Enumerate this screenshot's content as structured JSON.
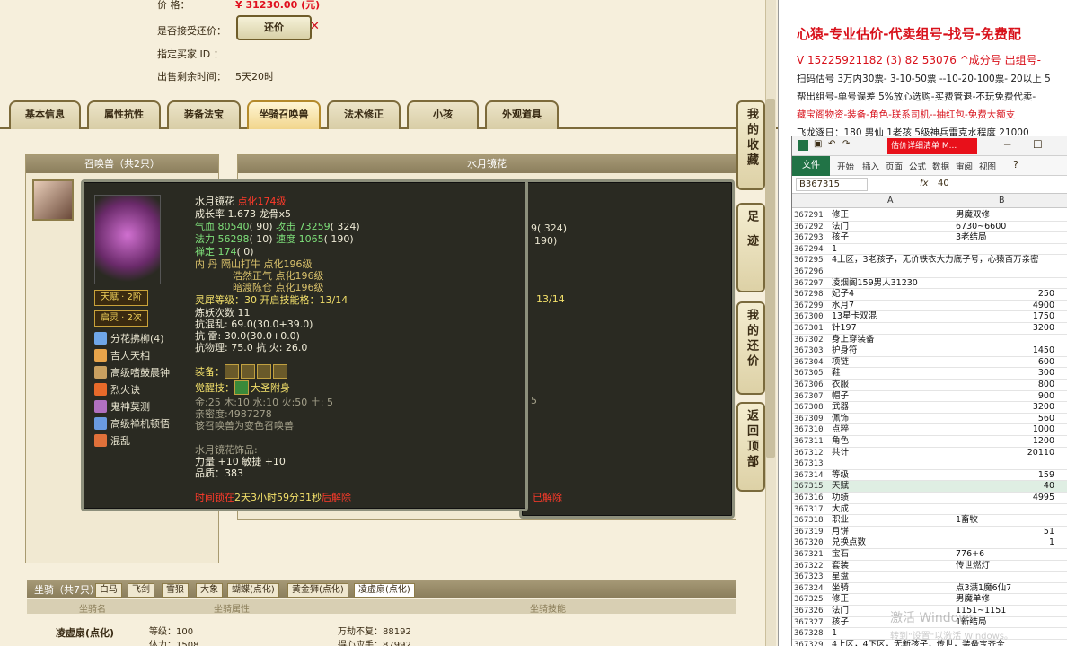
{
  "listing": {
    "price_label": "价        格：",
    "price_value": "¥ 31230.00 (元)",
    "accept_counter_label": "是否接受还价：",
    "counter_button": "还价",
    "counter_close": "✕",
    "buyer_label": "指定买家 ID ：",
    "time_left_label": "出售剩余时间：",
    "time_left_value": "5天20时"
  },
  "tabs": [
    "基本信息",
    "属性抗性",
    "装备法宝",
    "坐骑召唤兽",
    "法术修正",
    "小孩",
    "外观道具"
  ],
  "active_tab": 3,
  "summon_panel": {
    "header": "召唤兽（共2只）",
    "detail_header": "水月镜花"
  },
  "behind_panel": {
    "frag1": "9( 324)",
    "frag2": "190)",
    "frag3": "13/14",
    "frag4": "5",
    "frag5": "已解除"
  },
  "side_buttons": [
    "我的收藏",
    "足迹",
    "我的还价",
    "返回顶部"
  ],
  "tooltip": {
    "name": "水月镜花",
    "level": "点化174级",
    "growth": "成长率 1.673 龙骨x5",
    "hp_label": "气血 ",
    "hp_value": "80540",
    "hp_add": "( 90)",
    "atk_label": " 攻击 ",
    "atk_value": "73259",
    "atk_add": "( 324)",
    "mp_label": "法力 ",
    "mp_value": "56298",
    "mp_add": "( 10)",
    "spd_label": " 速度 ",
    "spd_value": "1065",
    "spd_add": "( 190)",
    "zen_label": "禅定 ",
    "zen_value": "174",
    "zen_add": "( 0)",
    "dan1": "内    丹 隔山打牛 点化196级",
    "dan2": "浩然正气 点化196级",
    "dan3": "暗渡陈仓 点化196级",
    "spirit": "灵犀等级：30 开启技能格：13/14",
    "refine": "炼妖次数 11",
    "res1": "抗混乱: 69.0(30.0+39.0)",
    "res2": "抗    雷: 30.0(30.0+0.0)",
    "res3": "抗物理: 75.0 抗    火: 26.0",
    "equip_label": "装备：",
    "awaken_label": "觉醒技：",
    "awaken_value": "大圣附身",
    "elements": "金:25 木:10 水:10 火:50 土: 5",
    "intimacy": "亲密度:4987278",
    "transform": "该召唤兽为变色召唤兽",
    "deco_title": "水月镜花饰品:",
    "deco_stats": "力量 +10 敏捷 +10",
    "deco_quality": "品质：383",
    "lock_prefix": "时间锁在",
    "lock_time": "2天3小时59分31秒",
    "lock_suffix": "后解除",
    "badge1": "天赋 · 2阶",
    "badge2": "启灵 · 2次",
    "skills": [
      "分花拂柳(4)",
      "吉人天相",
      "高级嗜鼓晨钟",
      "烈火诀",
      "鬼神莫测",
      "高级禅机顿悟",
      "混乱"
    ],
    "skill_colors": [
      "#6fa6e8",
      "#e8a44a",
      "#c9a060",
      "#e86a2a",
      "#b070c0",
      "#6a9ae0",
      "#e0703a"
    ]
  },
  "mount": {
    "header": "坐骑（共7只）",
    "tabs": [
      "白马",
      "飞剑",
      "雪狼",
      "大象",
      "蝴蝶(点化)",
      "黄金狮(点化)",
      "凌虚扇(点化)"
    ],
    "col1": "坐骑名",
    "col2": "坐骑属性",
    "col3": "坐骑技能",
    "name": "凌虚扇(点化)",
    "level": "等级：100",
    "stamina": "体力：1508",
    "skill1": "万劫不复：88192",
    "skill2": "得心应手：87992"
  },
  "ad": {
    "headline": "心猿-专业估价-代卖组号-找号-免费配",
    "line1": "V 15225921182    (3) 82  53076 ^成分号  出组号-",
    "line2": "扫码估号 3万内30票- 3-10-50票  --10-20-100票- 20以上 5",
    "line3": "帮出组号-单号误差 5%放心选购-买费管退-不玩免费代卖-",
    "line4": "藏宝阁物资-装备-角色-联系司机--抽红包-免费大额支",
    "line5": "飞龙逐日：180 男仙 1老孩 5级神兵雷克水程度 21000"
  },
  "excel": {
    "title_box": "估价详细清单 M...",
    "file_tab": "文件",
    "ribbon_tabs": [
      "开始",
      "插入",
      "页面",
      "公式",
      "数据",
      "审阅",
      "视图"
    ],
    "name_box": "B367315",
    "fx": "fx",
    "formula_value": "40",
    "col_a": "A",
    "col_b": "B",
    "rows": [
      {
        "n": "367291",
        "a": "修正",
        "b": "男魔双修",
        "num": false
      },
      {
        "n": "367292",
        "a": "法门",
        "b": "6730~6600",
        "num": false
      },
      {
        "n": "367293",
        "a": "孩子",
        "b": "3老结局",
        "num": false
      },
      {
        "n": "367294",
        "a": "                         1",
        "b": "",
        "num": false
      },
      {
        "n": "367295",
        "a": "4上区，3老孩子，无价铁衣大力底子号，心猿百万亲密",
        "b": "",
        "num": false
      },
      {
        "n": "367296",
        "a": "",
        "b": "",
        "num": false
      },
      {
        "n": "367297",
        "a": "凌烟阁159男人31230",
        "b": "",
        "num": false
      },
      {
        "n": "367298",
        "a": "妃子4",
        "b": "250",
        "num": true
      },
      {
        "n": "367299",
        "a": "水月7",
        "b": "4900",
        "num": true
      },
      {
        "n": "367300",
        "a": "13星卡双混",
        "b": "1750",
        "num": true
      },
      {
        "n": "367301",
        "a": "针197",
        "b": "3200",
        "num": true
      },
      {
        "n": "367302",
        "a": "身上穿装备",
        "b": "",
        "num": false
      },
      {
        "n": "367303",
        "a": "护身符",
        "b": "1450",
        "num": true
      },
      {
        "n": "367304",
        "a": "项链",
        "b": "600",
        "num": true
      },
      {
        "n": "367305",
        "a": "鞋",
        "b": "300",
        "num": true
      },
      {
        "n": "367306",
        "a": "衣服",
        "b": "800",
        "num": true
      },
      {
        "n": "367307",
        "a": "帽子",
        "b": "900",
        "num": true
      },
      {
        "n": "367308",
        "a": "武器",
        "b": "3200",
        "num": true
      },
      {
        "n": "367309",
        "a": "佩饰",
        "b": "560",
        "num": true
      },
      {
        "n": "367310",
        "a": "点粹",
        "b": "1000",
        "num": true
      },
      {
        "n": "367311",
        "a": "角色",
        "b": "1200",
        "num": true
      },
      {
        "n": "367312",
        "a": "共计",
        "b": "20110",
        "num": true
      },
      {
        "n": "367313",
        "a": "",
        "b": "",
        "num": false
      },
      {
        "n": "367314",
        "a": "等级",
        "b": "159",
        "num": true
      },
      {
        "n": "367315",
        "a": "天赋",
        "b": "40",
        "num": true
      },
      {
        "n": "367316",
        "a": "功绩",
        "b": "4995",
        "num": true
      },
      {
        "n": "367317",
        "a": "大成",
        "b": "",
        "num": false
      },
      {
        "n": "367318",
        "a": "职业",
        "b": "1畜牧",
        "num": false
      },
      {
        "n": "367319",
        "a": "月饼",
        "b": "51",
        "num": true
      },
      {
        "n": "367320",
        "a": "兑换点数",
        "b": "1",
        "num": true
      },
      {
        "n": "367321",
        "a": "宝石",
        "b": "776+6",
        "num": false
      },
      {
        "n": "367322",
        "a": "套装",
        "b": "传世燃灯",
        "num": false
      },
      {
        "n": "367323",
        "a": "星盘",
        "b": "",
        "num": false
      },
      {
        "n": "367324",
        "a": "坐骑",
        "b": "点3满1魔6仙7",
        "num": false
      },
      {
        "n": "367325",
        "a": "修正",
        "b": "男魔单修",
        "num": false
      },
      {
        "n": "367326",
        "a": "法门",
        "b": "1151~1151",
        "num": false
      },
      {
        "n": "367327",
        "a": "孩子",
        "b": "1新结局",
        "num": false
      },
      {
        "n": "367328",
        "a": "                         1",
        "b": "",
        "num": false
      },
      {
        "n": "367329",
        "a": "4上区，4下区，无新孩子，传世，装备宝齐全",
        "b": "",
        "num": false
      }
    ],
    "watermark": "激活 Windows",
    "watermark2": "转到\"设置\"以激活 Windows。"
  }
}
